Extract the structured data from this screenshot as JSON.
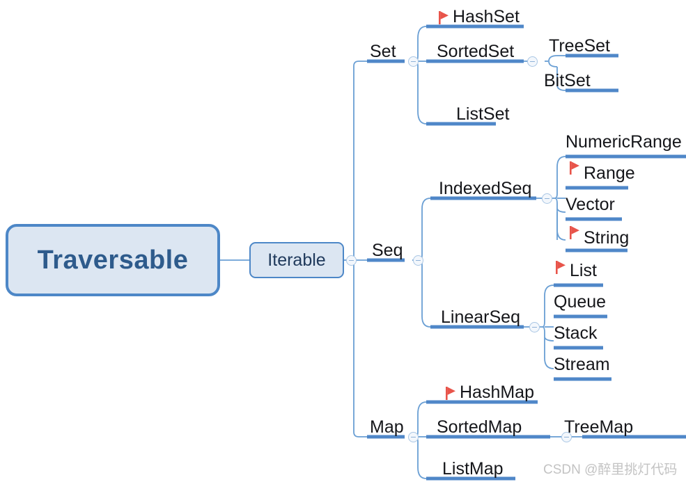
{
  "diagram": {
    "title": "Scala collections hierarchy mind map",
    "root": {
      "label": "Traversable"
    },
    "level1": {
      "label": "Iterable"
    },
    "colors": {
      "node_border": "#4d87c7",
      "node_fill": "#dce6f2",
      "root_text": "#2e5b8c",
      "underline": "#4f87c8",
      "connector": "#6a9fd4",
      "flag": "#e8544a",
      "topic_text": "#15161a",
      "background": "#ffffff",
      "watermark_text": "#c3c3c3"
    },
    "branches": [
      {
        "label": "Set",
        "children": [
          {
            "label": "HashSet",
            "flag": true,
            "children": []
          },
          {
            "label": "SortedSet",
            "flag": false,
            "children": [
              {
                "label": "TreeSet",
                "flag": false
              },
              {
                "label": "BitSet",
                "flag": false
              }
            ]
          },
          {
            "label": "ListSet",
            "flag": false,
            "children": []
          }
        ]
      },
      {
        "label": "Seq",
        "children": [
          {
            "label": "IndexedSeq",
            "flag": false,
            "children": [
              {
                "label": "NumericRange",
                "flag": false
              },
              {
                "label": "Range",
                "flag": true
              },
              {
                "label": "Vector",
                "flag": false
              },
              {
                "label": "String",
                "flag": true
              }
            ]
          },
          {
            "label": "LinearSeq",
            "flag": false,
            "children": [
              {
                "label": "List",
                "flag": true
              },
              {
                "label": "Queue",
                "flag": false
              },
              {
                "label": "Stack",
                "flag": false
              },
              {
                "label": "Stream",
                "flag": false
              }
            ]
          }
        ]
      },
      {
        "label": "Map",
        "children": [
          {
            "label": "HashMap",
            "flag": true,
            "children": []
          },
          {
            "label": "SortedMap",
            "flag": false,
            "children": [
              {
                "label": "TreeMap",
                "flag": false
              }
            ]
          },
          {
            "label": "ListMap",
            "flag": false,
            "children": []
          }
        ]
      }
    ]
  },
  "watermark": {
    "text": "CSDN @醉里挑灯代码"
  }
}
